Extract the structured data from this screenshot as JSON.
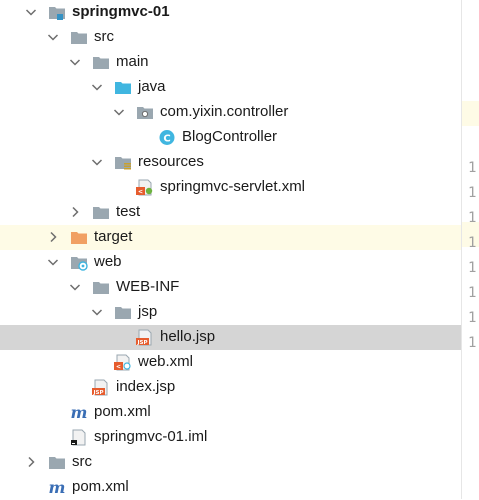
{
  "tree": [
    {
      "id": "springmvc-01",
      "label": "springmvc-01",
      "depth": 0,
      "expanded": true,
      "icon": "module-folder-icon",
      "bold": true
    },
    {
      "id": "src",
      "label": "src",
      "depth": 1,
      "expanded": true,
      "icon": "folder-icon"
    },
    {
      "id": "main",
      "label": "main",
      "depth": 2,
      "expanded": true,
      "icon": "folder-icon"
    },
    {
      "id": "java",
      "label": "java",
      "depth": 3,
      "expanded": true,
      "icon": "source-folder-icon"
    },
    {
      "id": "controller-package",
      "label": "com.yixin.controller",
      "depth": 4,
      "expanded": true,
      "icon": "package-icon"
    },
    {
      "id": "blogcontroller",
      "label": "BlogController",
      "depth": 5,
      "icon": "class-icon"
    },
    {
      "id": "resources",
      "label": "resources",
      "depth": 3,
      "expanded": true,
      "icon": "resources-folder-icon"
    },
    {
      "id": "springmvc-servlet-xml",
      "label": "springmvc-servlet.xml",
      "depth": 4,
      "icon": "spring-xml-icon"
    },
    {
      "id": "test",
      "label": "test",
      "depth": 2,
      "expanded": false,
      "icon": "folder-icon"
    },
    {
      "id": "target",
      "label": "target",
      "depth": 1,
      "expanded": false,
      "icon": "excluded-folder-icon",
      "highlight": "yellow"
    },
    {
      "id": "web",
      "label": "web",
      "depth": 1,
      "expanded": true,
      "icon": "web-folder-icon"
    },
    {
      "id": "web-inf",
      "label": "WEB-INF",
      "depth": 2,
      "expanded": true,
      "icon": "folder-icon"
    },
    {
      "id": "jsp",
      "label": "jsp",
      "depth": 3,
      "expanded": true,
      "icon": "folder-icon"
    },
    {
      "id": "hello-jsp",
      "label": "hello.jsp",
      "depth": 4,
      "icon": "jsp-file-icon",
      "highlight": "selected"
    },
    {
      "id": "web-xml",
      "label": "web.xml",
      "depth": 3,
      "icon": "web-xml-icon"
    },
    {
      "id": "index-jsp",
      "label": "index.jsp",
      "depth": 2,
      "icon": "jsp-file-icon"
    },
    {
      "id": "pom-xml-inner",
      "label": "pom.xml",
      "depth": 1,
      "icon": "maven-icon"
    },
    {
      "id": "iml",
      "label": "springmvc-01.iml",
      "depth": 1,
      "icon": "iml-file-icon"
    },
    {
      "id": "src-root",
      "label": "src",
      "depth": 0,
      "expanded": false,
      "icon": "folder-icon"
    },
    {
      "id": "pom-xml-root",
      "label": "pom.xml",
      "depth": 0,
      "icon": "maven-icon"
    }
  ],
  "gutter_numbers": [
    "1",
    "1",
    "1",
    "1",
    "1",
    "1",
    "1",
    "1"
  ],
  "colors": {
    "folder": "#9aa7b0",
    "source_folder": "#40b6e0",
    "excluded_folder": "#f1a063",
    "class_icon": "#40b6e0",
    "jsp": "#e65c2e",
    "maven": "#3a6eb5",
    "selected_bg": "#d5d5d5",
    "yellow_bg": "#fefbe6"
  }
}
